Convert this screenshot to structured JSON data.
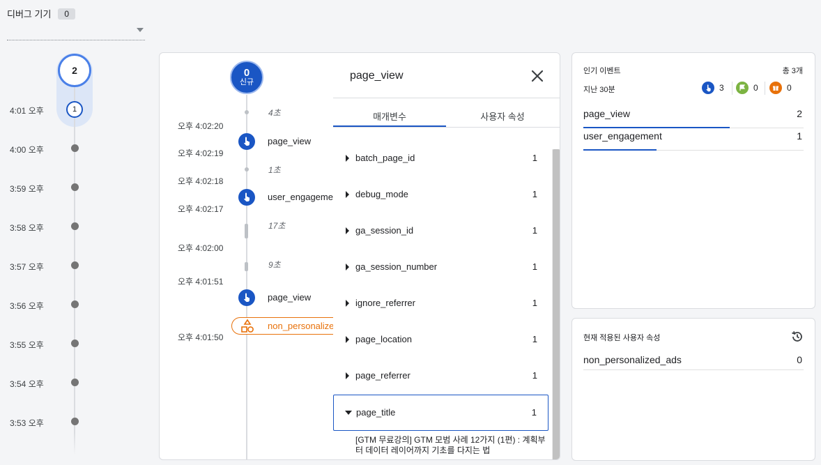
{
  "device": {
    "label": "디버그 기기",
    "count": "0"
  },
  "minutes": {
    "top_count": "2",
    "current_count": "1",
    "labels": [
      "4:01 오후",
      "4:00 오후",
      "3:59 오후",
      "3:58 오후",
      "3:57 오후",
      "3:56 오후",
      "3:55 오후",
      "3:54 오후",
      "3:53 오후"
    ]
  },
  "stream": {
    "new_count": "0",
    "new_label": "신규",
    "gaps": [
      "4초",
      "1초",
      "17초",
      "9초"
    ],
    "timestamps": [
      "오후 4:02:20",
      "오후 4:02:19",
      "오후 4:02:18",
      "오후 4:02:17",
      "오후 4:02:00",
      "오후 4:01:51",
      "오후 4:01:50"
    ],
    "events": [
      "page_view",
      "user_engagement",
      "page_view",
      "non_personalized_ads"
    ]
  },
  "detail": {
    "title": "page_view",
    "tabs": [
      "매개변수",
      "사용자 속성"
    ],
    "params": [
      {
        "name": "batch_page_id",
        "count": "1"
      },
      {
        "name": "debug_mode",
        "count": "1"
      },
      {
        "name": "ga_session_id",
        "count": "1"
      },
      {
        "name": "ga_session_number",
        "count": "1"
      },
      {
        "name": "ignore_referrer",
        "count": "1"
      },
      {
        "name": "page_location",
        "count": "1"
      },
      {
        "name": "page_referrer",
        "count": "1"
      },
      {
        "name": "page_title",
        "count": "1"
      }
    ],
    "page_title_value": "[GTM 무료강의] GTM 모범 사례 12가지 (1편) : 계획부터 데이터 레이어까지 기초를 다지는 법"
  },
  "top_events": {
    "title": "인기 이벤트",
    "total": "총 3개",
    "period": "지난 30분",
    "stats": [
      {
        "icon": "pointer-icon",
        "value": "3",
        "color": "#1a56c4"
      },
      {
        "icon": "flag-icon",
        "value": "0",
        "color": "#7cb342"
      },
      {
        "icon": "gift-icon",
        "value": "0",
        "color": "#e8710a"
      }
    ],
    "rows": [
      {
        "name": "page_view",
        "count": "2",
        "share": 0.667
      },
      {
        "name": "user_engagement",
        "count": "1",
        "share": 0.333
      }
    ]
  },
  "user_props": {
    "title": "현재 적용된 사용자 속성",
    "rows": [
      {
        "name": "non_personalized_ads",
        "value": "0"
      }
    ]
  }
}
